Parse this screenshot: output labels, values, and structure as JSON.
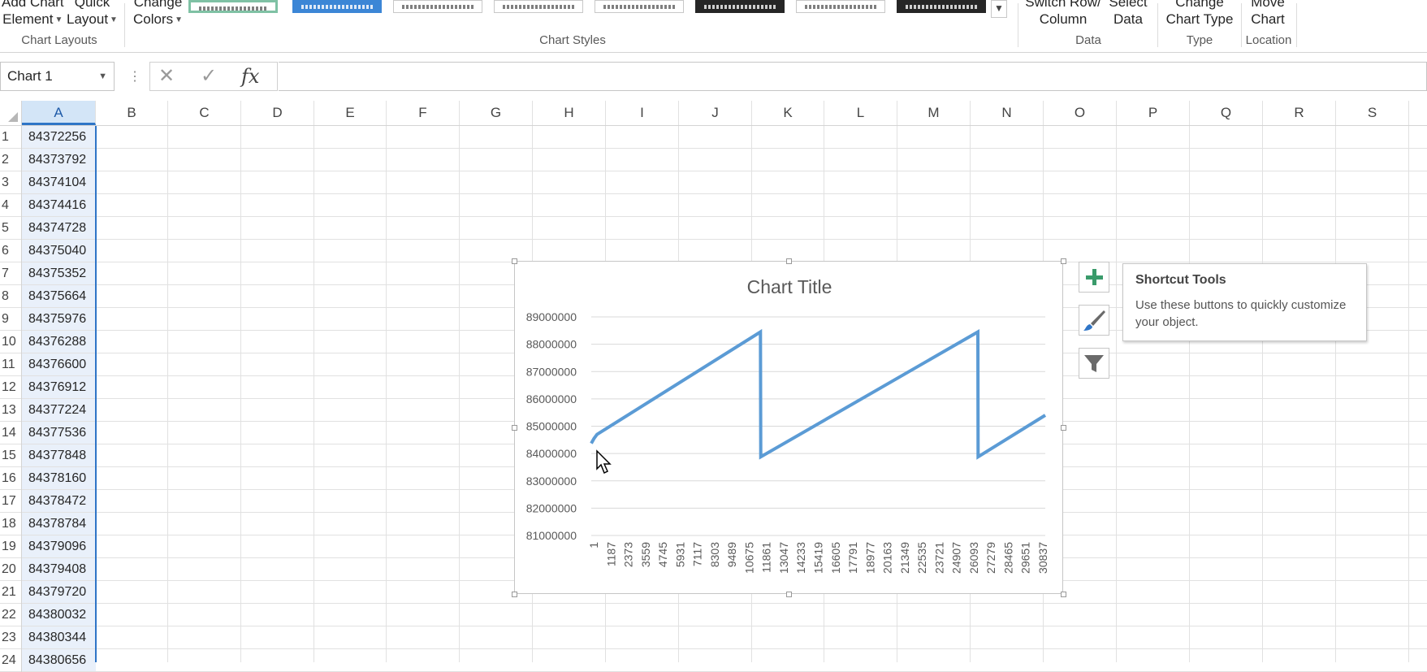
{
  "ribbon": {
    "add_chart_element": [
      "Add Chart",
      "Element"
    ],
    "quick_layout": [
      "Quick",
      "Layout"
    ],
    "change_colors": [
      "Change",
      "Colors"
    ],
    "chart_layouts_label": "Chart Layouts",
    "chart_styles_label": "Chart Styles",
    "switch_row_column": [
      "Switch Row/",
      "Column"
    ],
    "select_data": [
      "Select",
      "Data"
    ],
    "data_label": "Data",
    "change_chart_type": [
      "Change",
      "Chart Type"
    ],
    "type_label": "Type",
    "move_chart": [
      "Move",
      "Chart"
    ],
    "location_label": "Location"
  },
  "formula_bar": {
    "name_box": "Chart 1",
    "cancel_symbol": "✕",
    "enter_symbol": "✓",
    "fx_symbol": "fx",
    "formula": ""
  },
  "columns": [
    "A",
    "B",
    "C",
    "D",
    "E",
    "F",
    "G",
    "H",
    "I",
    "J",
    "K",
    "L",
    "M",
    "N",
    "O",
    "P",
    "Q",
    "R",
    "S"
  ],
  "rows": [
    {
      "n": "1",
      "a": "84372256"
    },
    {
      "n": "2",
      "a": "84373792"
    },
    {
      "n": "3",
      "a": "84374104"
    },
    {
      "n": "4",
      "a": "84374416"
    },
    {
      "n": "5",
      "a": "84374728"
    },
    {
      "n": "6",
      "a": "84375040"
    },
    {
      "n": "7",
      "a": "84375352"
    },
    {
      "n": "8",
      "a": "84375664"
    },
    {
      "n": "9",
      "a": "84375976"
    },
    {
      "n": "10",
      "a": "84376288"
    },
    {
      "n": "11",
      "a": "84376600"
    },
    {
      "n": "12",
      "a": "84376912"
    },
    {
      "n": "13",
      "a": "84377224"
    },
    {
      "n": "14",
      "a": "84377536"
    },
    {
      "n": "15",
      "a": "84377848"
    },
    {
      "n": "16",
      "a": "84378160"
    },
    {
      "n": "17",
      "a": "84378472"
    },
    {
      "n": "18",
      "a": "84378784"
    },
    {
      "n": "19",
      "a": "84379096"
    },
    {
      "n": "20",
      "a": "84379408"
    },
    {
      "n": "21",
      "a": "84379720"
    },
    {
      "n": "22",
      "a": "84380032"
    },
    {
      "n": "23",
      "a": "84380344"
    },
    {
      "n": "24",
      "a": "84380656"
    }
  ],
  "chart": {
    "title": "Chart Title"
  },
  "chart_data": {
    "type": "line",
    "title": "Chart Title",
    "xlabel": "",
    "ylabel": "",
    "ylim": [
      81000000,
      89000000
    ],
    "yticks": [
      "89000000",
      "88000000",
      "87000000",
      "86000000",
      "85000000",
      "84000000",
      "83000000",
      "82000000",
      "81000000"
    ],
    "x_ticks": [
      "1",
      "1187",
      "2373",
      "3559",
      "4745",
      "5931",
      "7117",
      "8303",
      "9489",
      "10675",
      "11861",
      "13047",
      "14233",
      "15419",
      "16605",
      "17791",
      "18977",
      "20163",
      "21349",
      "22535",
      "23721",
      "24907",
      "26093",
      "27279",
      "28465",
      "29651",
      "30837"
    ],
    "x_range": [
      1,
      33000
    ],
    "series": [
      {
        "values": [
          {
            "x": 1,
            "y": 84372256
          },
          {
            "x": 200,
            "y": 84550000
          },
          {
            "x": 420,
            "y": 84700000
          },
          {
            "x": 12300,
            "y": 88450000
          },
          {
            "x": 12320,
            "y": 83880000
          },
          {
            "x": 28100,
            "y": 88450000
          },
          {
            "x": 28120,
            "y": 83880000
          },
          {
            "x": 33000,
            "y": 85400000
          }
        ]
      }
    ],
    "grid": true,
    "legend": "none",
    "line_color": "#5b9bd5"
  },
  "tooltip": {
    "title": "Shortcut Tools",
    "body": "Use these buttons to quickly customize your object."
  },
  "icons": {
    "add": "plus-icon",
    "style": "paintbrush-icon",
    "filter": "funnel-icon"
  }
}
